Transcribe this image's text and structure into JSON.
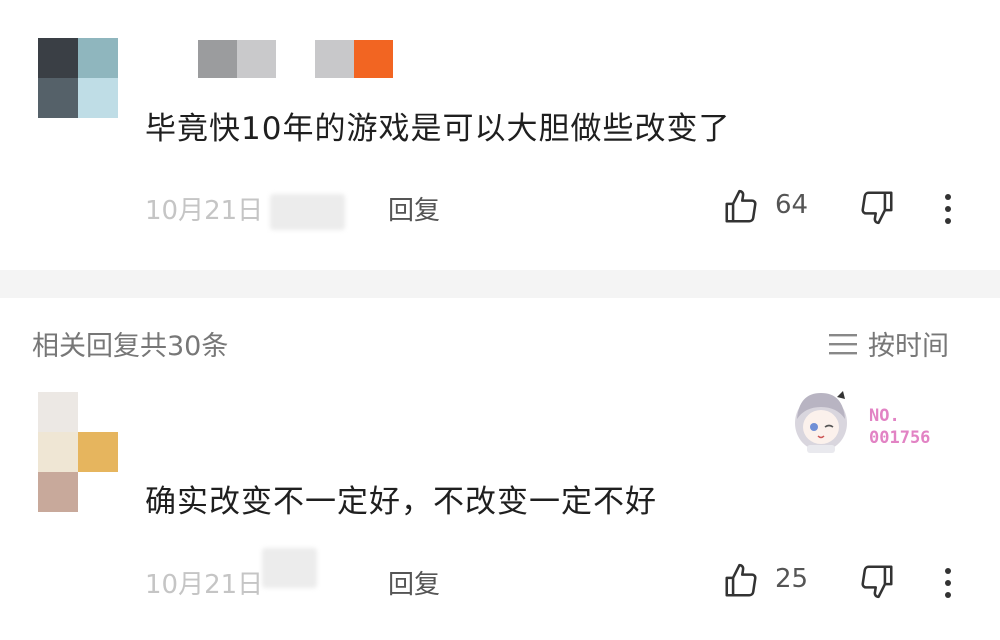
{
  "comments": [
    {
      "text": "毕竟快10年的游戏是可以大胆做些改变了",
      "date": "10月21日",
      "reply_label": "回复",
      "like_count": "64"
    },
    {
      "text": "确实改变不一定好，不改变一定不好",
      "date": "10月21日",
      "reply_label": "回复",
      "like_count": "25",
      "badge": {
        "line1": "NO.",
        "line2": "001756"
      }
    }
  ],
  "related": {
    "title": "相关回复共30条",
    "sort_label": "按时间"
  },
  "colors": {
    "badge_pink": "#e283c4",
    "accent_orange": "#f26522"
  }
}
